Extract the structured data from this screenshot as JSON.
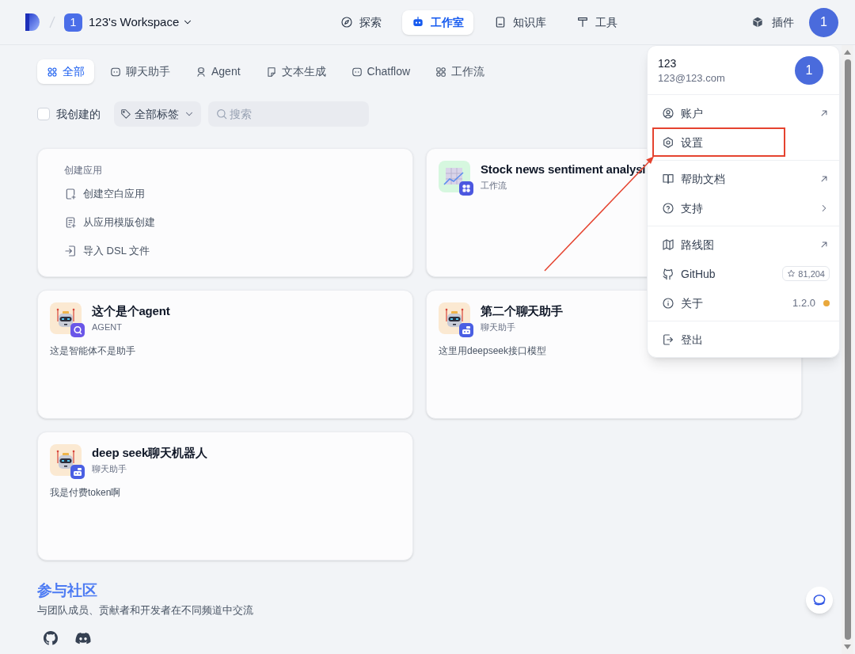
{
  "header": {
    "workspace": {
      "badge": "1",
      "name": "123's Workspace"
    },
    "nav": [
      {
        "kind": "explore",
        "label": "探索",
        "selected": false
      },
      {
        "kind": "studio",
        "label": "工作室",
        "selected": true
      },
      {
        "kind": "knowledge",
        "label": "知识库",
        "selected": false
      },
      {
        "kind": "tools",
        "label": "工具",
        "selected": false
      }
    ],
    "plugins": {
      "label": "插件"
    },
    "avatar": "1"
  },
  "filters": {
    "tabs": [
      {
        "kind": "all",
        "label": "全部",
        "selected": true
      },
      {
        "kind": "chatbot",
        "label": "聊天助手",
        "selected": false
      },
      {
        "kind": "agent",
        "label": "Agent",
        "selected": false
      },
      {
        "kind": "completion",
        "label": "文本生成",
        "selected": false
      },
      {
        "kind": "chatflow",
        "label": "Chatflow",
        "selected": false
      },
      {
        "kind": "workflow",
        "label": "工作流",
        "selected": false
      }
    ],
    "created_by_me": {
      "label": "我创建的",
      "checked": false
    },
    "tag_select": {
      "label": "全部标签"
    },
    "search": {
      "placeholder": "搜索"
    }
  },
  "create_card": {
    "title": "创建应用",
    "actions": [
      {
        "kind": "blank",
        "label": "创建空白应用"
      },
      {
        "kind": "template",
        "label": "从应用模版创建"
      },
      {
        "kind": "import",
        "label": "导入 DSL 文件"
      }
    ]
  },
  "apps": [
    {
      "kind": "workflow",
      "name": "Stock news sentiment analysi",
      "type": "工作流"
    },
    {
      "kind": "agent",
      "name": "这个是个agent",
      "type": "AGENT",
      "description": "这是智能体不是助手"
    },
    {
      "kind": "chatbot",
      "name": "第二个聊天助手",
      "type": "聊天助手",
      "description": "这里用deepseek接口模型"
    },
    {
      "kind": "chatbot",
      "name": "deep seek聊天机器人",
      "type": "聊天助手",
      "description": "我是付费token啊"
    }
  ],
  "community": {
    "title": "参与社区",
    "subtitle": "与团队成员、贡献者和开发者在不同频道中交流",
    "links": [
      {
        "kind": "github"
      },
      {
        "kind": "discord"
      }
    ]
  },
  "account_menu": {
    "name": "123",
    "email": "123@123.com",
    "avatar": "1",
    "sections": [
      {
        "items": [
          {
            "kind": "account",
            "label": "账户",
            "annotated": false
          },
          {
            "kind": "settings",
            "label": "设置",
            "annotated": true
          }
        ]
      },
      {
        "items": [
          {
            "kind": "docs",
            "label": "帮助文档",
            "annotated": false
          },
          {
            "kind": "support",
            "label": "支持",
            "annotated": false
          }
        ]
      },
      {
        "items": [
          {
            "kind": "roadmap",
            "label": "路线图",
            "annotated": false
          },
          {
            "kind": "github",
            "label": "GitHub",
            "star_count": "81,204",
            "annotated": false
          },
          {
            "kind": "about",
            "label": "关于",
            "version": "1.2.0",
            "badge_dot": true,
            "annotated": false
          }
        ]
      },
      {
        "items": [
          {
            "kind": "logout",
            "label": "登出",
            "annotated": false
          }
        ]
      }
    ]
  }
}
